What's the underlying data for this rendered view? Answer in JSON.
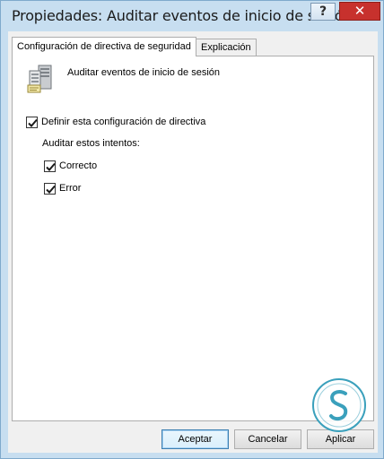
{
  "window": {
    "title": "Propiedades: Auditar eventos de inicio de sesión",
    "help_glyph": "?",
    "close_glyph": "✕"
  },
  "tabs": [
    {
      "label": "Configuración de directiva de seguridad",
      "active": true
    },
    {
      "label": "Explicación",
      "active": false
    }
  ],
  "policy": {
    "name": "Auditar eventos de inicio de sesión",
    "icon": "server-policy-icon"
  },
  "define_setting": {
    "label": "Definir esta configuración de directiva",
    "checked": true
  },
  "audit_attempts_label": "Auditar estos intentos:",
  "attempts": [
    {
      "label": "Correcto",
      "checked": true
    },
    {
      "label": "Error",
      "checked": true
    }
  ],
  "buttons": {
    "ok": "Aceptar",
    "cancel": "Cancelar",
    "apply": "Aplicar"
  },
  "colors": {
    "title_bar": "#c7def0",
    "close_button": "#c7312d",
    "watermark": "#3aa0bc"
  }
}
